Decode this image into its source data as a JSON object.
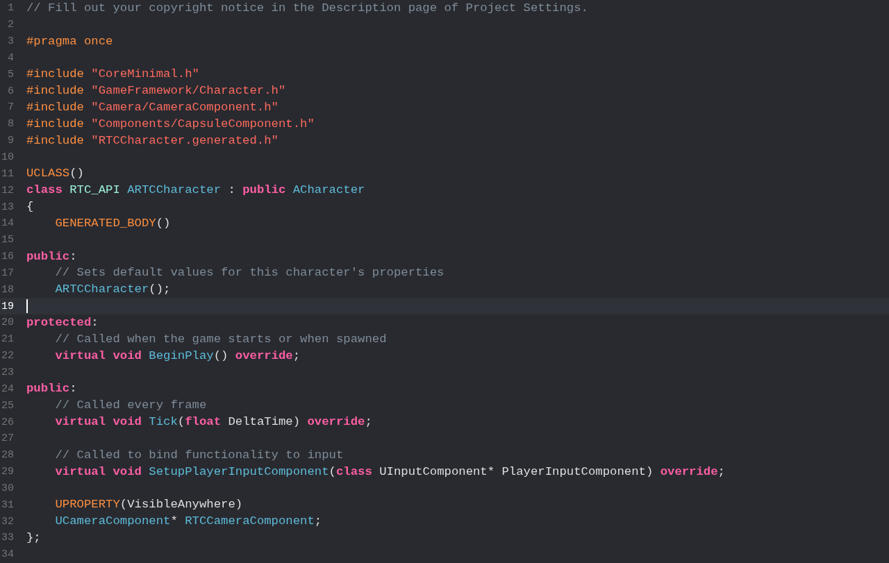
{
  "editor": {
    "lines": [
      {
        "number": "1",
        "current": false,
        "tokens": [
          {
            "kind": "comment",
            "text": "// Fill out your copyright notice in the Description page of Project Settings."
          }
        ]
      },
      {
        "number": "2",
        "current": false
      },
      {
        "number": "3",
        "current": false,
        "tokens": [
          {
            "kind": "preproc",
            "text": "#pragma once"
          }
        ]
      },
      {
        "number": "4",
        "current": false
      },
      {
        "number": "5",
        "current": false,
        "tokens": [
          {
            "kind": "preproc",
            "text": "#include "
          },
          {
            "kind": "string",
            "text": "\"CoreMinimal.h\""
          }
        ]
      },
      {
        "number": "6",
        "current": false,
        "tokens": [
          {
            "kind": "preproc",
            "text": "#include "
          },
          {
            "kind": "string",
            "text": "\"GameFramework/Character.h\""
          }
        ]
      },
      {
        "number": "7",
        "current": false,
        "tokens": [
          {
            "kind": "preproc",
            "text": "#include "
          },
          {
            "kind": "string",
            "text": "\"Camera/CameraComponent.h\""
          }
        ]
      },
      {
        "number": "8",
        "current": false,
        "tokens": [
          {
            "kind": "preproc",
            "text": "#include "
          },
          {
            "kind": "string",
            "text": "\"Components/CapsuleComponent.h\""
          }
        ]
      },
      {
        "number": "9",
        "current": false,
        "tokens": [
          {
            "kind": "preproc",
            "text": "#include "
          },
          {
            "kind": "string",
            "text": "\"RTCCharacter.generated.h\""
          }
        ]
      },
      {
        "number": "10",
        "current": false
      },
      {
        "number": "11",
        "current": false,
        "tokens": [
          {
            "kind": "macro",
            "text": "UCLASS"
          },
          {
            "kind": "plain",
            "text": "()"
          }
        ]
      },
      {
        "number": "12",
        "current": false,
        "tokens": [
          {
            "kind": "keyword",
            "text": "class "
          },
          {
            "kind": "ident",
            "text": "RTC_API "
          },
          {
            "kind": "type",
            "text": "ARTCCharacter"
          },
          {
            "kind": "plain",
            "text": " : "
          },
          {
            "kind": "keyword",
            "text": "public "
          },
          {
            "kind": "type",
            "text": "ACharacter"
          }
        ]
      },
      {
        "number": "13",
        "current": false,
        "tokens": [
          {
            "kind": "plain",
            "text": "{"
          }
        ]
      },
      {
        "number": "14",
        "current": false,
        "tokens": [
          {
            "kind": "macro",
            "text": "    GENERATED_BODY"
          },
          {
            "kind": "plain",
            "text": "()"
          }
        ]
      },
      {
        "number": "15",
        "current": false
      },
      {
        "number": "16",
        "current": false,
        "tokens": [
          {
            "kind": "keyword",
            "text": "public"
          },
          {
            "kind": "plain",
            "text": ":"
          }
        ]
      },
      {
        "number": "17",
        "current": false,
        "tokens": [
          {
            "kind": "comment",
            "text": "    // Sets default values for this character's properties"
          }
        ]
      },
      {
        "number": "18",
        "current": false,
        "tokens": [
          {
            "kind": "type",
            "text": "    ARTCCharacter"
          },
          {
            "kind": "plain",
            "text": "();"
          }
        ]
      },
      {
        "number": "19",
        "current": true
      },
      {
        "number": "20",
        "current": false,
        "tokens": [
          {
            "kind": "keyword",
            "text": "protected"
          },
          {
            "kind": "plain",
            "text": ":"
          }
        ]
      },
      {
        "number": "21",
        "current": false,
        "tokens": [
          {
            "kind": "comment",
            "text": "    // Called when the game starts or when spawned"
          }
        ]
      },
      {
        "number": "22",
        "current": false,
        "tokens": [
          {
            "kind": "keyword",
            "text": "    virtual void "
          },
          {
            "kind": "type",
            "text": "BeginPlay"
          },
          {
            "kind": "plain",
            "text": "() "
          },
          {
            "kind": "keyword",
            "text": "override"
          },
          {
            "kind": "plain",
            "text": ";"
          }
        ]
      },
      {
        "number": "23",
        "current": false
      },
      {
        "number": "24",
        "current": false,
        "tokens": [
          {
            "kind": "keyword",
            "text": "public"
          },
          {
            "kind": "plain",
            "text": ":"
          }
        ]
      },
      {
        "number": "25",
        "current": false,
        "tokens": [
          {
            "kind": "comment",
            "text": "    // Called every frame"
          }
        ]
      },
      {
        "number": "26",
        "current": false,
        "tokens": [
          {
            "kind": "keyword",
            "text": "    virtual void "
          },
          {
            "kind": "type",
            "text": "Tick"
          },
          {
            "kind": "plain",
            "text": "("
          },
          {
            "kind": "keyword",
            "text": "float "
          },
          {
            "kind": "plain",
            "text": "DeltaTime) "
          },
          {
            "kind": "keyword",
            "text": "override"
          },
          {
            "kind": "plain",
            "text": ";"
          }
        ]
      },
      {
        "number": "27",
        "current": false
      },
      {
        "number": "28",
        "current": false,
        "tokens": [
          {
            "kind": "comment",
            "text": "    // Called to bind functionality to input"
          }
        ]
      },
      {
        "number": "29",
        "current": false,
        "tokens": [
          {
            "kind": "keyword",
            "text": "    virtual void "
          },
          {
            "kind": "type",
            "text": "SetupPlayerInputComponent"
          },
          {
            "kind": "plain",
            "text": "("
          },
          {
            "kind": "keyword",
            "text": "class "
          },
          {
            "kind": "plain",
            "text": "UInputComponent* PlayerInputComponent) "
          },
          {
            "kind": "keyword",
            "text": "override"
          },
          {
            "kind": "plain",
            "text": ";"
          }
        ]
      },
      {
        "number": "30",
        "current": false
      },
      {
        "number": "31",
        "current": false,
        "tokens": [
          {
            "kind": "macro",
            "text": "    UPROPERTY"
          },
          {
            "kind": "plain",
            "text": "(VisibleAnywhere)"
          }
        ]
      },
      {
        "number": "32",
        "current": false,
        "tokens": [
          {
            "kind": "type",
            "text": "    UCameraComponent"
          },
          {
            "kind": "plain",
            "text": "* "
          },
          {
            "kind": "type",
            "text": "RTCCameraComponent"
          },
          {
            "kind": "plain",
            "text": ";"
          }
        ]
      },
      {
        "number": "33",
        "current": false,
        "tokens": [
          {
            "kind": "plain",
            "text": "};"
          }
        ]
      },
      {
        "number": "34",
        "current": false
      }
    ]
  }
}
